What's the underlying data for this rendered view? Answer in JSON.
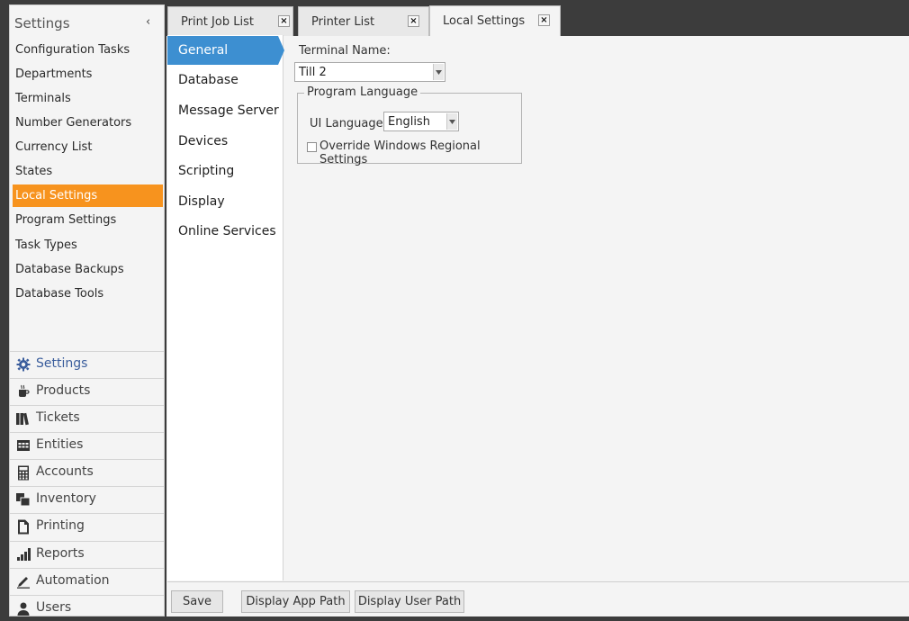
{
  "sidebar": {
    "title": "Settings",
    "collapse_glyph": "‹",
    "items": [
      {
        "label": "Configuration Tasks"
      },
      {
        "label": "Departments"
      },
      {
        "label": "Terminals"
      },
      {
        "label": "Number Generators"
      },
      {
        "label": "Currency List"
      },
      {
        "label": "States"
      },
      {
        "label": "Local Settings",
        "active": true
      },
      {
        "label": "Program Settings"
      },
      {
        "label": "Task Types"
      },
      {
        "label": "Database Backups"
      },
      {
        "label": "Database Tools"
      }
    ],
    "nav_buttons": [
      {
        "label": "Settings",
        "icon": "gear-icon",
        "active": true
      },
      {
        "label": "Products",
        "icon": "coffee-cup-icon"
      },
      {
        "label": "Tickets",
        "icon": "tickets-icon"
      },
      {
        "label": "Entities",
        "icon": "table-icon"
      },
      {
        "label": "Accounts",
        "icon": "calculator-icon"
      },
      {
        "label": "Inventory",
        "icon": "inventory-icon"
      },
      {
        "label": "Printing",
        "icon": "document-icon"
      },
      {
        "label": "Reports",
        "icon": "bar-chart-icon"
      },
      {
        "label": "Automation",
        "icon": "pen-icon"
      },
      {
        "label": "Users",
        "icon": "user-icon"
      }
    ]
  },
  "tabs": [
    {
      "label": "Print Job List",
      "close": "×"
    },
    {
      "label": "Printer List",
      "close": "×"
    },
    {
      "label": "Local Settings",
      "close": "×",
      "active": true
    }
  ],
  "subnav": {
    "items": [
      {
        "label": "General",
        "active": true
      },
      {
        "label": "Database"
      },
      {
        "label": "Message Server"
      },
      {
        "label": "Devices"
      },
      {
        "label": "Scripting"
      },
      {
        "label": "Display"
      },
      {
        "label": "Online Services"
      }
    ]
  },
  "form": {
    "terminal_name_label": "Terminal Name:",
    "terminal_name_value": "Till 2",
    "program_language_group": "Program Language",
    "ui_language_label": "UI Language:",
    "ui_language_value": "English",
    "override_label": "Override Windows Regional Settings",
    "override_checked": false
  },
  "footer": {
    "save": "Save",
    "display_app_path": "Display App Path",
    "display_user_path": "Display User Path"
  },
  "colors": {
    "accent_orange": "#f7931e",
    "accent_blue": "#3d8fd1"
  }
}
